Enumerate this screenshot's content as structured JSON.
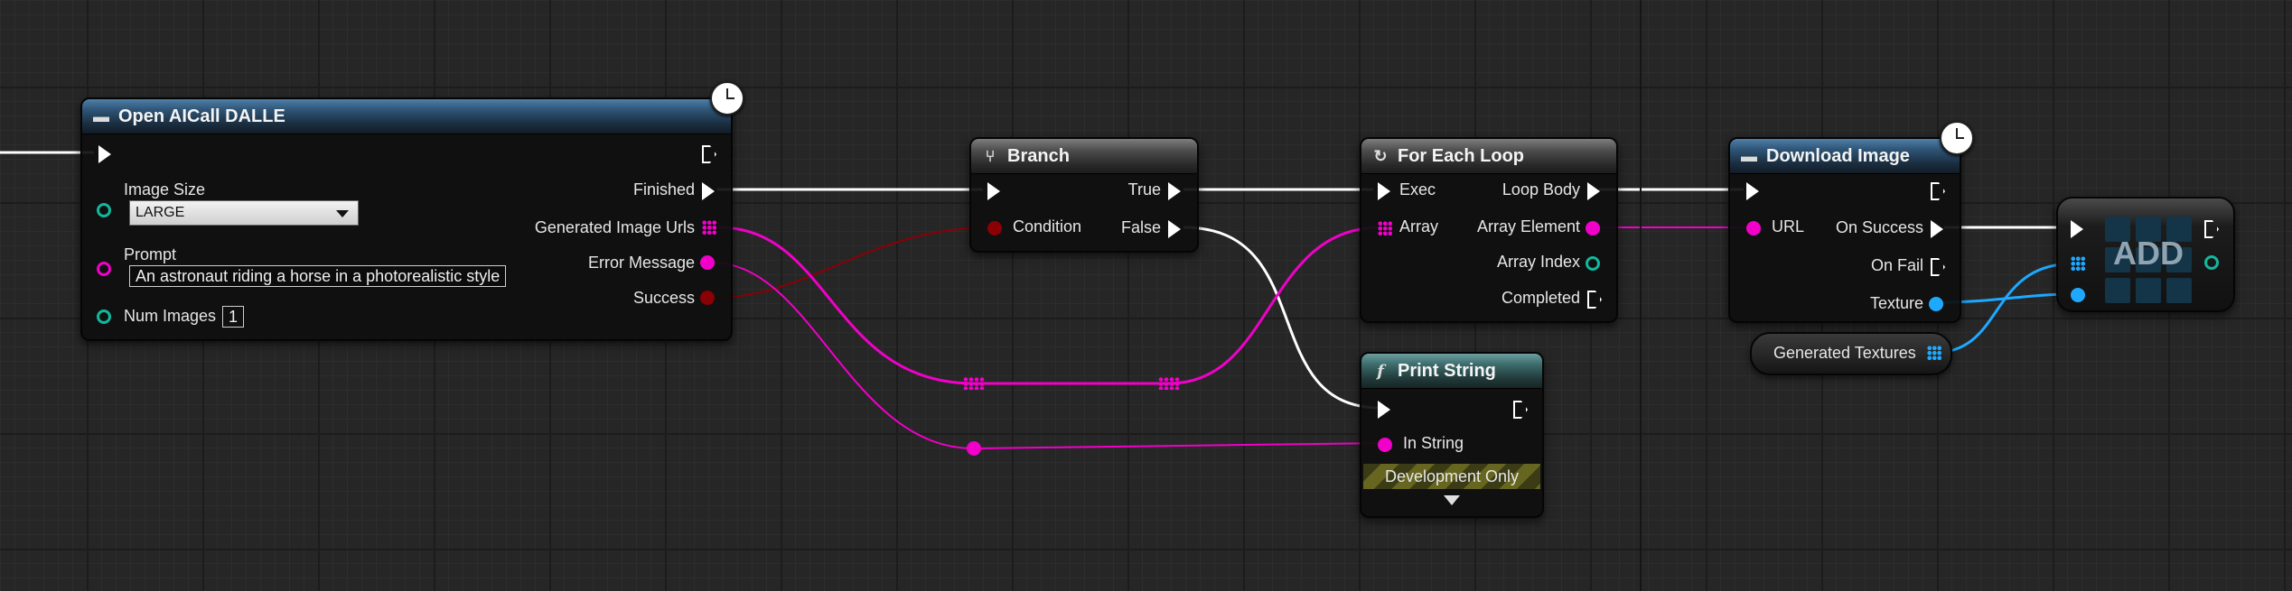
{
  "nodes": {
    "open_ai_call": {
      "title": "Open AICall DALLE",
      "image_size_label": "Image Size",
      "image_size_value": "LARGE",
      "prompt_label": "Prompt",
      "prompt_value": "An astronaut riding a horse in a photorealistic style",
      "num_images_label": "Num Images",
      "num_images_value": "1",
      "finished_label": "Finished",
      "urls_label": "Generated Image Urls",
      "error_label": "Error Message",
      "success_label": "Success"
    },
    "branch": {
      "title": "Branch",
      "condition_label": "Condition",
      "true_label": "True",
      "false_label": "False"
    },
    "for_each_loop": {
      "title": "For Each Loop",
      "exec_label": "Exec",
      "array_label": "Array",
      "loop_body_label": "Loop Body",
      "array_element_label": "Array Element",
      "array_index_label": "Array Index",
      "completed_label": "Completed"
    },
    "download_image": {
      "title": "Download Image",
      "url_label": "URL",
      "on_success_label": "On Success",
      "on_fail_label": "On Fail",
      "texture_label": "Texture"
    },
    "print_string": {
      "title": "Print String",
      "icon": "f",
      "in_string_label": "In String",
      "dev_only_label": "Development Only"
    },
    "generated_textures": {
      "label": "Generated Textures"
    },
    "add": {
      "label": "ADD"
    }
  },
  "colors": {
    "exec": "#ffffff",
    "string": "#f000c8",
    "bool": "#8a0005",
    "object": "#1ea9ff",
    "int": "#10b89d"
  }
}
